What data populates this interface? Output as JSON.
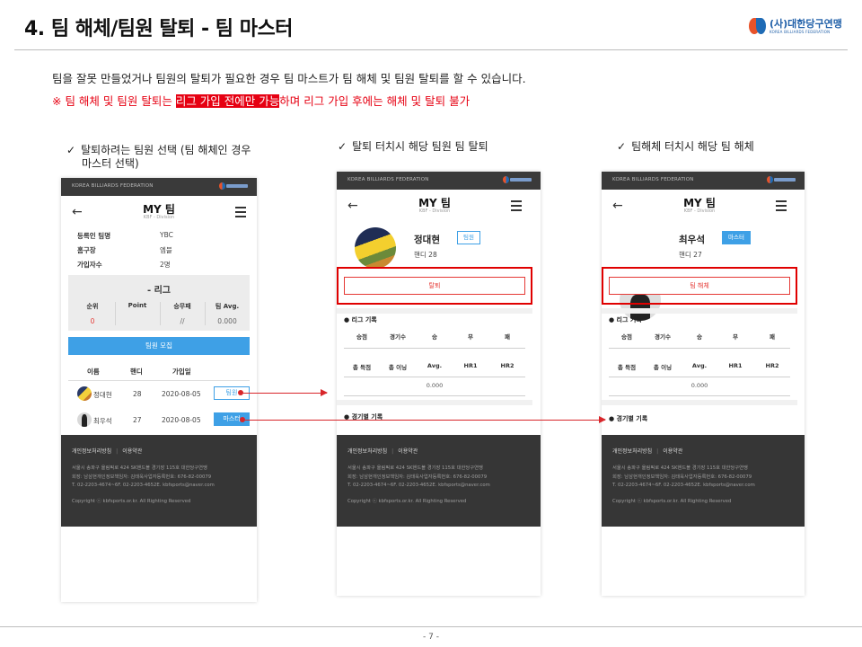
{
  "header": {
    "title": "4. 팀 해체/팀원 탈퇴 - 팀 마스터"
  },
  "logo": {
    "ko": "(사)대한당구연맹",
    "en": "KOREA BILLIARDS FEDERATION"
  },
  "intro": {
    "description": "팀을 잘못 만들었거나 팀원의 탈퇴가 필요한 경우 팀 마스트가 팀 해체 및 팀원 탈퇴를 할 수 있습니다.",
    "warning_prefix": "※ 팀 해체 및 팀원 탈퇴는 ",
    "warning_highlight": "리그 가입 전에만 가능",
    "warning_suffix": "하며 리그 가입 후에는 해체 및 탈퇴 불가"
  },
  "captions": {
    "left_line1": "탈퇴하려는 팀원 선택 (팀 해체인 경우",
    "left_line2": "마스터 선택)",
    "middle": "탈퇴 터치시 해당 팀원 팀 탈퇴",
    "right": "팀해체 터치시 해당 팀 해체"
  },
  "common": {
    "topbar_text": "KOREA BILLIARDS FEDERATION",
    "back": "←",
    "screen_title": "MY 팀",
    "screen_subtitle": "KBF - Division",
    "footer": {
      "privacy": "개인정보처리방침",
      "terms": "이용약관",
      "separator": "|",
      "addr1": "서울시 송파구 올림픽로 424 SK핸드볼 경기장 115호 대한당구연맹",
      "addr2": "회장: 남삼현개인정보책임자: 김태욱사업자등록번호: 676-82-00079",
      "addr3": "T. 02-2203-4674~6F. 02-2203-4652E. kbfsports@naver.com",
      "copyright": "Copyright ⓒ kbfsports.or.kr. All Righting Reserved"
    }
  },
  "team_screen": {
    "info": [
      {
        "label": "등록인 팀명",
        "value": "YBC"
      },
      {
        "label": "홈구장",
        "value": "엠블"
      },
      {
        "label": "가입자수",
        "value": "2명"
      }
    ],
    "league": {
      "title": "- 리그",
      "cols": [
        {
          "label": "순위",
          "value": "0"
        },
        {
          "label": "Point",
          "value": ""
        },
        {
          "label": "승무패",
          "value": "//"
        },
        {
          "label": "팀 Avg.",
          "value": "0.000"
        }
      ]
    },
    "recruit_button": "팀원 모집",
    "member_headers": [
      "이름",
      "핸디",
      "가입일"
    ],
    "members": [
      {
        "name": "정대현",
        "handicap": "28",
        "joined": "2020-08-05",
        "role": "팀원"
      },
      {
        "name": "최우석",
        "handicap": "27",
        "joined": "2020-08-05",
        "role": "마스터"
      }
    ]
  },
  "detail_member": {
    "name": "정대현",
    "handicap": "핸디 28",
    "badge": "팀원",
    "action": "탈퇴"
  },
  "detail_master": {
    "name": "최우석",
    "handicap": "핸디 27",
    "badge": "마스터",
    "action": "팀 해체"
  },
  "records": {
    "league_title": "● 리그 기록",
    "row1": [
      "승점",
      "경기수",
      "승",
      "무",
      "패"
    ],
    "row2": [
      "총 득점",
      "총 이닝",
      "Avg.",
      "HR1",
      "HR2"
    ],
    "avg_value": "0.000",
    "match_title": "● 경기별 기록"
  },
  "colors": {
    "accent": "#3ea0e6",
    "warning": "#e60012",
    "footer_bg": "#363636"
  },
  "page_number": "- 7 -"
}
